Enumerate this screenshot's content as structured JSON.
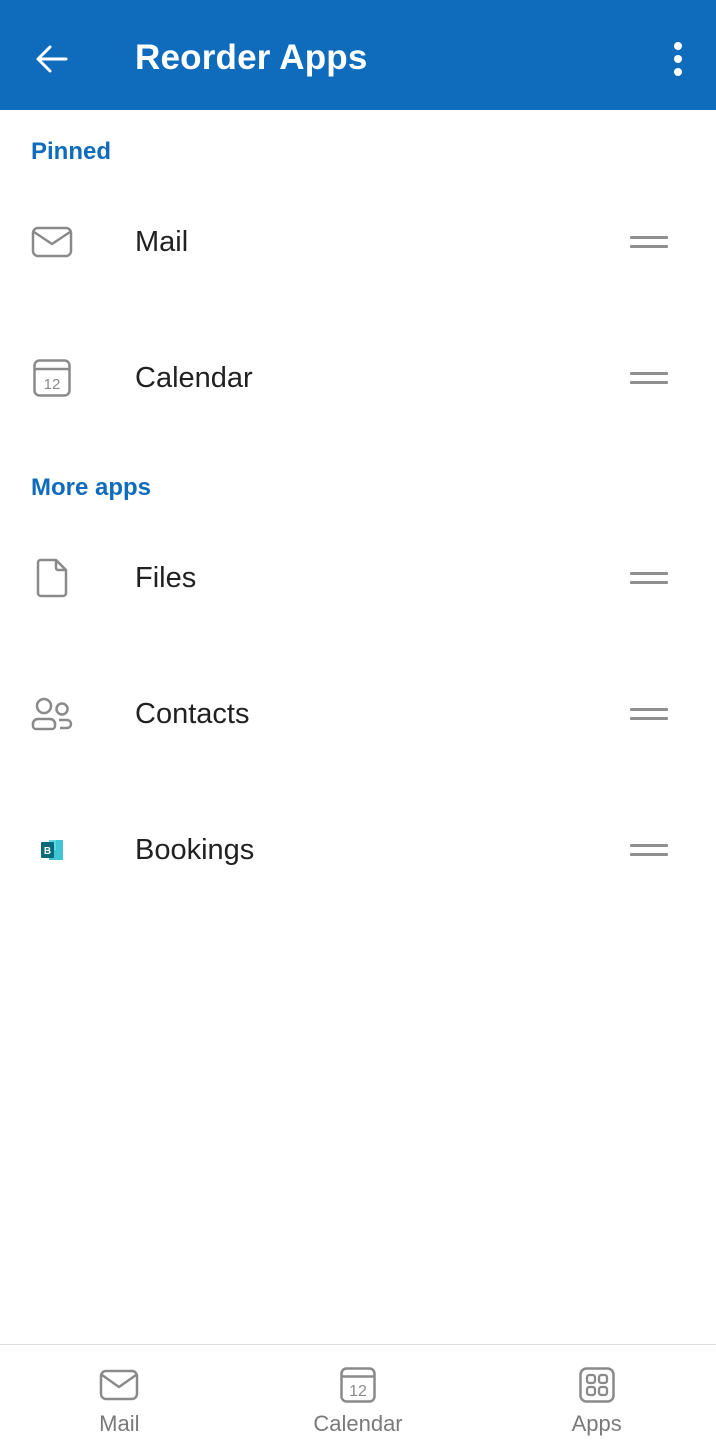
{
  "header": {
    "title": "Reorder Apps",
    "back_icon": "arrow-left-icon",
    "more_icon": "more-vertical-icon",
    "background": "#0f6cbd"
  },
  "sections": {
    "pinned": {
      "title": "Pinned",
      "items": [
        {
          "label": "Mail",
          "icon": "mail-icon"
        },
        {
          "label": "Calendar",
          "icon": "calendar-icon",
          "icon_text": "12"
        }
      ]
    },
    "more_apps": {
      "title": "More apps",
      "items": [
        {
          "label": "Files",
          "icon": "file-icon"
        },
        {
          "label": "Contacts",
          "icon": "contacts-icon"
        },
        {
          "label": "Bookings",
          "icon": "bookings-icon",
          "icon_text": "B"
        }
      ]
    }
  },
  "bottom_nav": {
    "items": [
      {
        "label": "Mail",
        "icon": "mail-icon"
      },
      {
        "label": "Calendar",
        "icon": "calendar-icon",
        "icon_text": "12"
      },
      {
        "label": "Apps",
        "icon": "apps-grid-icon"
      }
    ]
  },
  "colors": {
    "accent": "#0f6cbd",
    "icon_gray": "#8a8a8a",
    "bookings_teal": "#13a3b5"
  }
}
